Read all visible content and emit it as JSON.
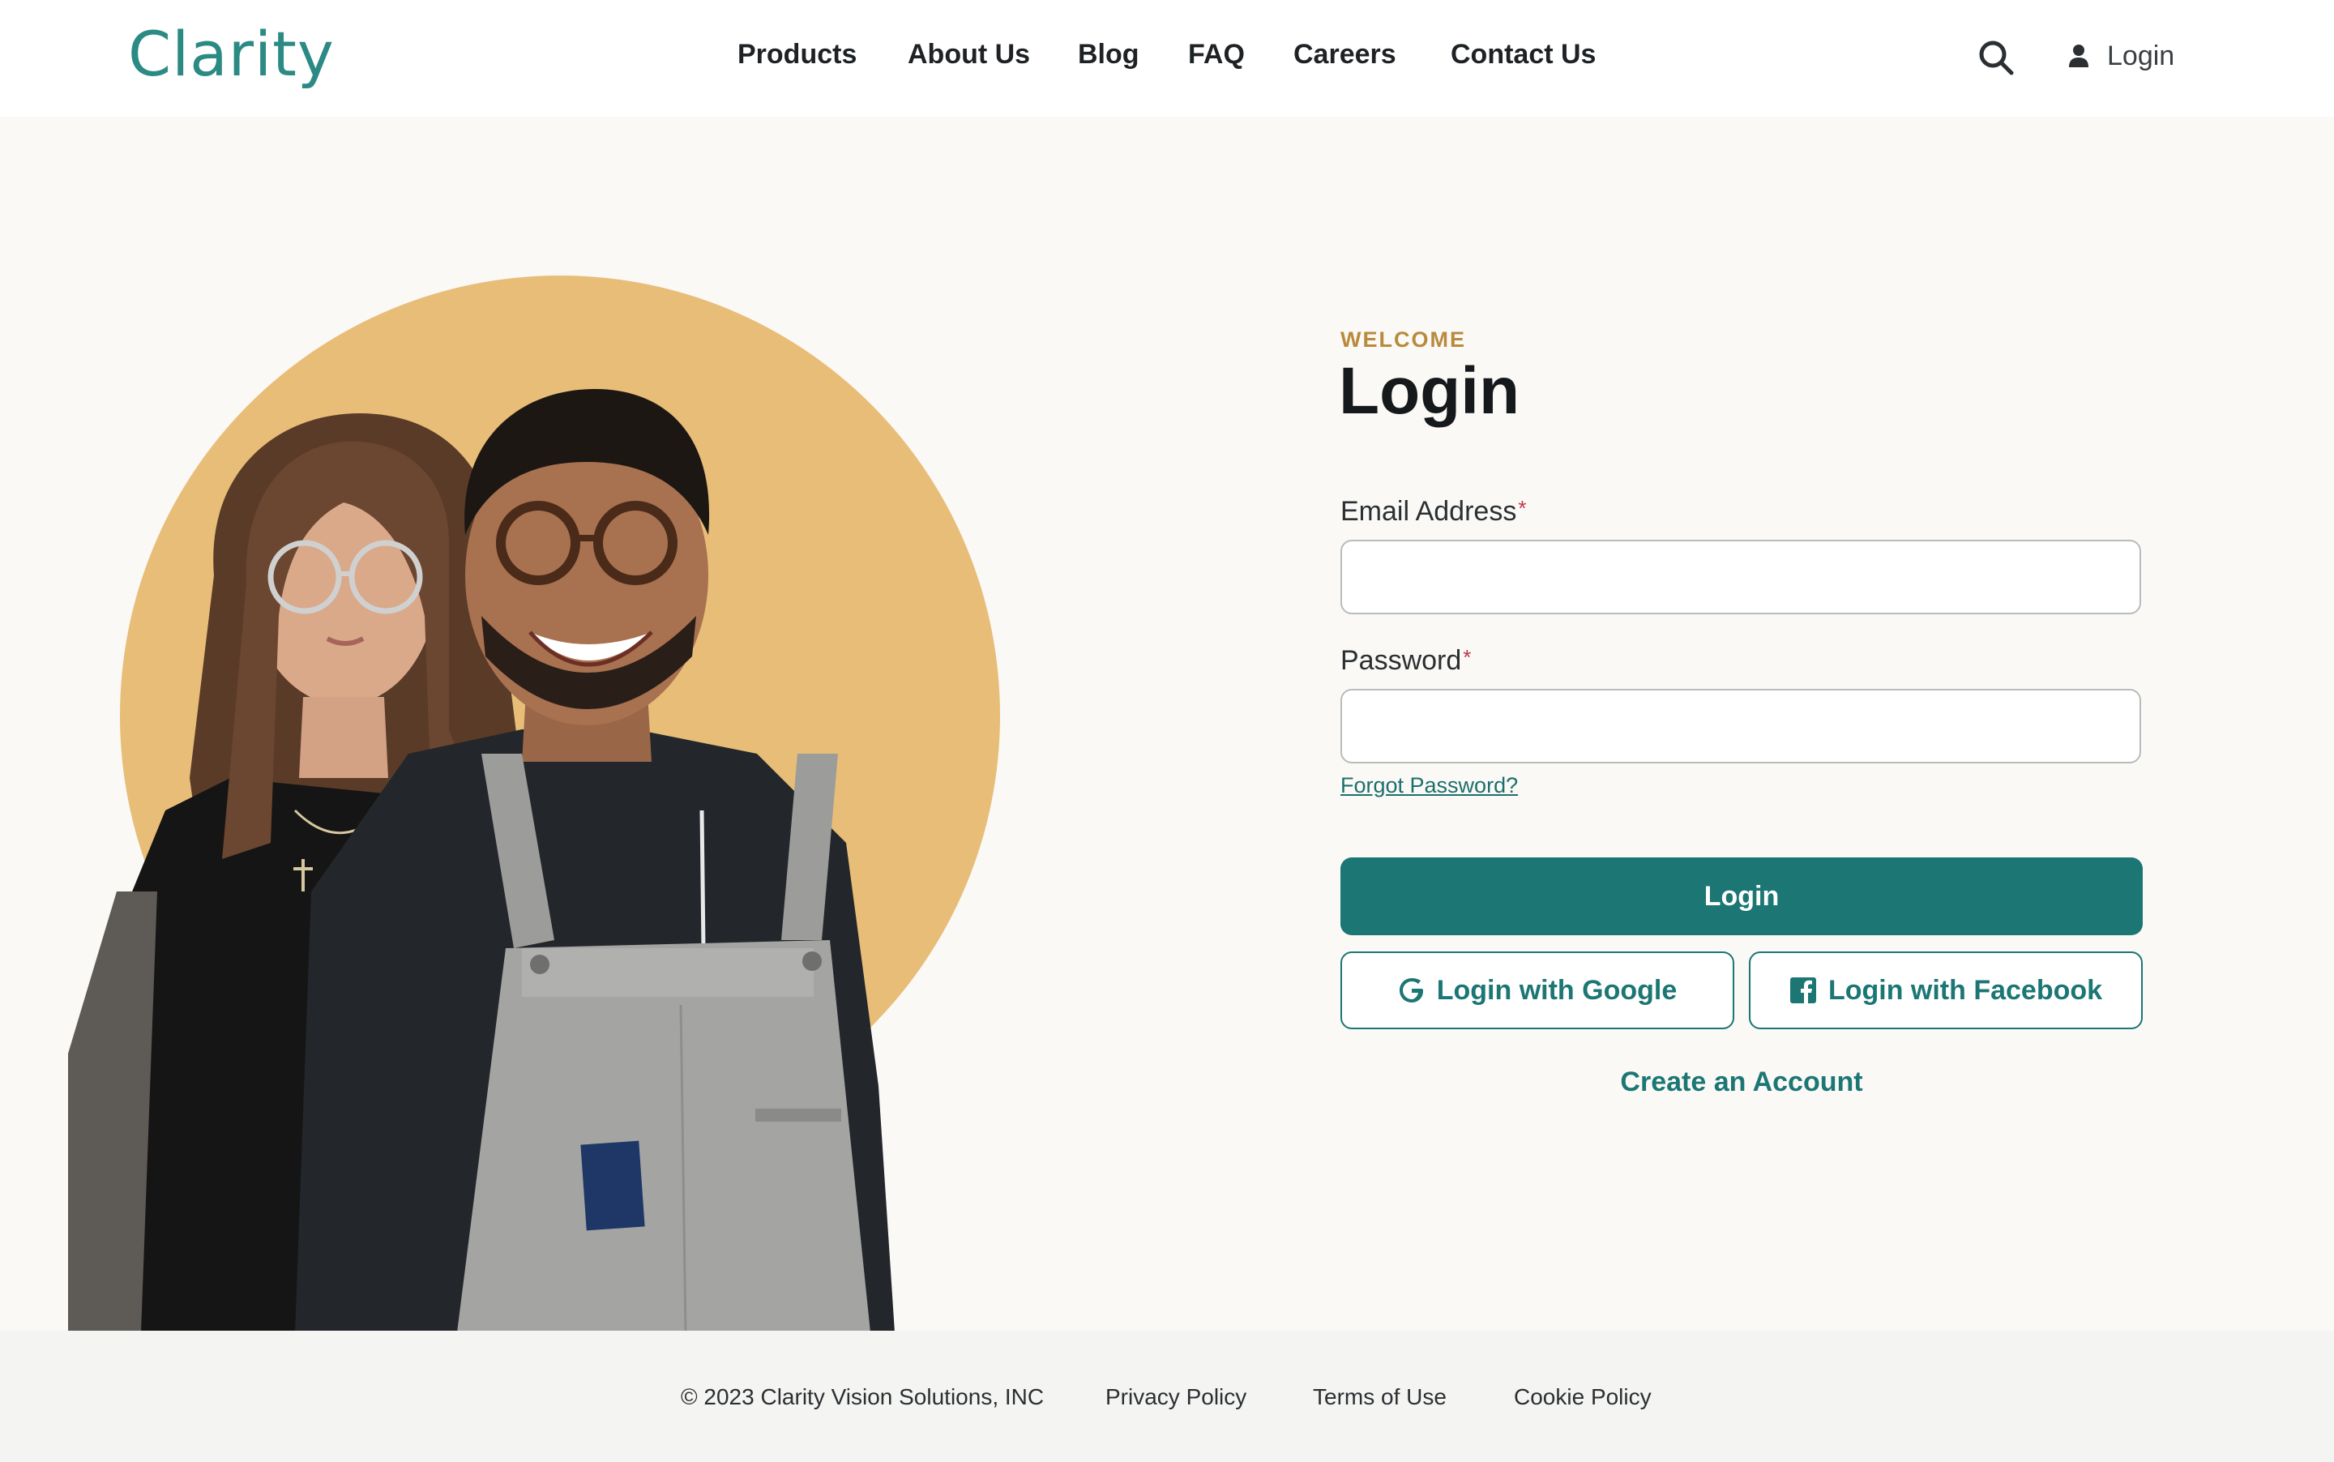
{
  "header": {
    "logo": "Clarity",
    "nav": [
      {
        "label": "Products"
      },
      {
        "label": "About Us"
      },
      {
        "label": "Blog"
      },
      {
        "label": "FAQ"
      },
      {
        "label": "Careers"
      },
      {
        "label": "Contact Us"
      }
    ],
    "search_icon": "search-icon",
    "login_label": "Login",
    "user_icon": "user-icon"
  },
  "form": {
    "eyebrow": "WELCOME",
    "title": "Login",
    "email_label": "Email Address",
    "email_value": "",
    "password_label": "Password",
    "password_value": "",
    "required_mark": "*",
    "forgot_label": "Forgot Password?",
    "login_button": "Login",
    "google_button": "Login with Google",
    "facebook_button": "Login with Facebook",
    "create_account": "Create an Account"
  },
  "footer": {
    "copyright": "© 2023 Clarity Vision Solutions, INC",
    "links": [
      {
        "label": "Privacy Policy"
      },
      {
        "label": "Terms of Use"
      },
      {
        "label": "Cookie Policy"
      }
    ]
  },
  "colors": {
    "brand": "#2b8a84",
    "primary_button": "#1b7674",
    "accent": "#b98a3c",
    "background": "#faf9f6",
    "hero_circle": "#e8bd78",
    "required": "#c2334d"
  }
}
